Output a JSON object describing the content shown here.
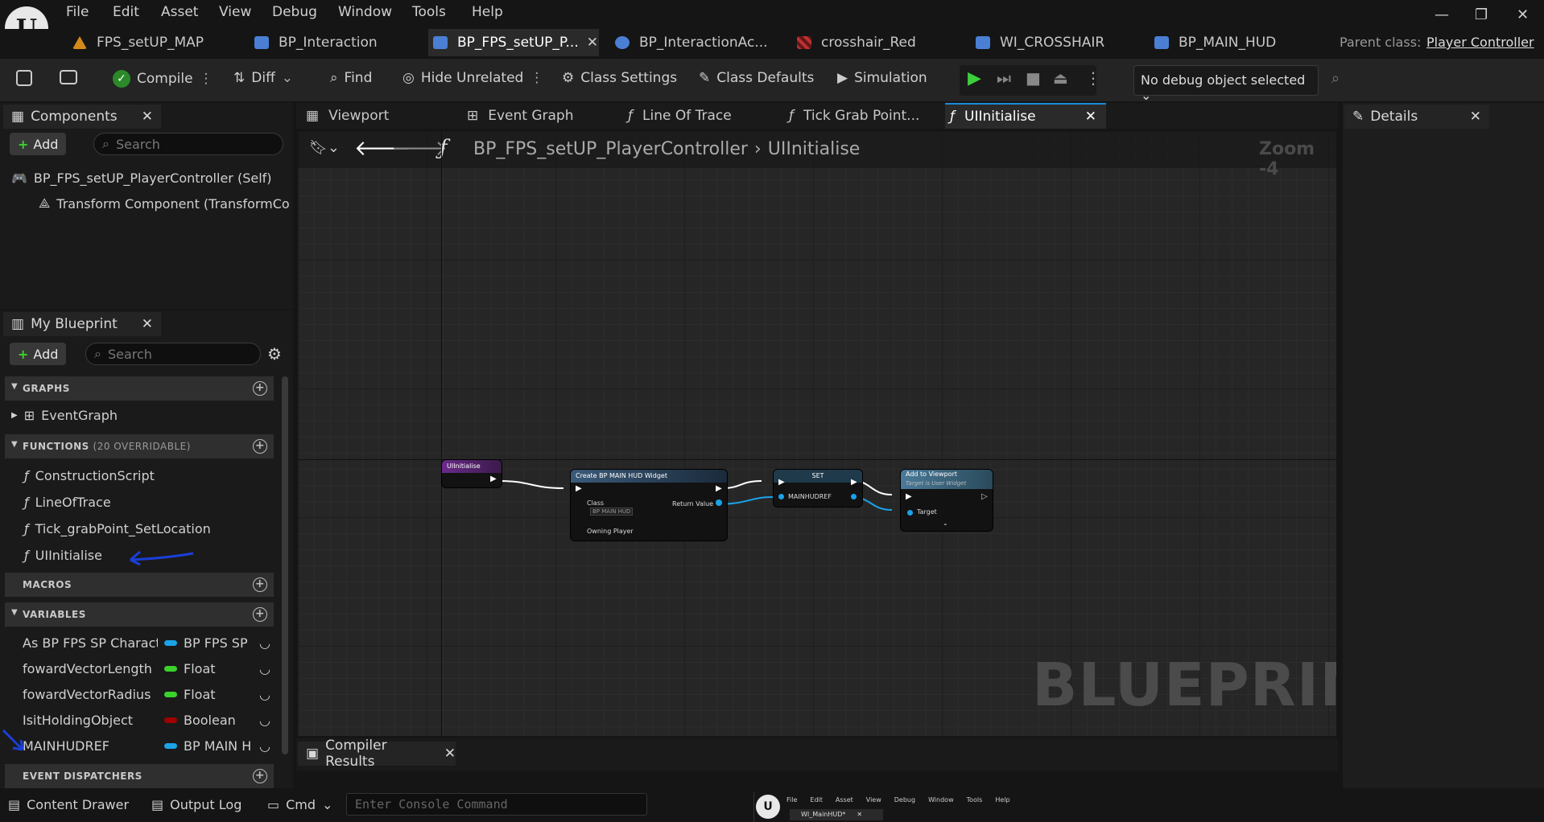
{
  "menu": [
    "File",
    "Edit",
    "Asset",
    "View",
    "Debug",
    "Window",
    "Tools",
    "Help"
  ],
  "doc_tabs": [
    {
      "label": "FPS_setUP_MAP",
      "color": "#d48a1a"
    },
    {
      "label": "BP_Interaction",
      "color": "#4a7fd4"
    },
    {
      "label": "BP_FPS_setUP_P...",
      "color": "#4a7fd4"
    },
    {
      "label": "BP_InteractionAc...",
      "color": "#4a7fd4"
    },
    {
      "label": "crosshair_Red",
      "color": "#c03030"
    },
    {
      "label": "WI_CROSSHAIR",
      "color": "#4a7fd4"
    },
    {
      "label": "BP_MAIN_HUD",
      "color": "#4a7fd4"
    }
  ],
  "parent_class": {
    "label": "Parent class:",
    "value": "Player Controller"
  },
  "toolbar": {
    "compile": "Compile",
    "diff": "Diff",
    "find": "Find",
    "hide_unrelated": "Hide Unrelated",
    "class_settings": "Class Settings",
    "class_defaults": "Class Defaults",
    "simulation": "Simulation",
    "debug_select": "No debug object selected"
  },
  "components": {
    "title": "Components",
    "add": "Add",
    "search_placeholder": "Search",
    "items": [
      "BP_FPS_setUP_PlayerController (Self)",
      "Transform Component (TransformCo"
    ]
  },
  "my_blueprint": {
    "title": "My Blueprint",
    "add": "Add",
    "search_placeholder": "Search",
    "graphs_header": "GRAPHS",
    "graphs": [
      "EventGraph"
    ],
    "functions_header": "FUNCTIONS",
    "functions_suffix": "(20 OVERRIDABLE)",
    "functions": [
      "ConstructionScript",
      "LineOfTrace",
      "Tick_grabPoint_SetLocation",
      "UIInitialise"
    ],
    "macros_header": "MACROS",
    "variables_header": "VARIABLES",
    "variables": [
      {
        "name": "As BP FPS SP Charact",
        "type": "BP FPS SP",
        "color": "#1aa3e8"
      },
      {
        "name": "fowardVectorLength",
        "type": "Float",
        "color": "#3bd22b"
      },
      {
        "name": "fowardVectorRadius",
        "type": "Float",
        "color": "#3bd22b"
      },
      {
        "name": "IsitHoldingObject",
        "type": "Boolean",
        "color": "#a00000"
      },
      {
        "name": "MAINHUDREF",
        "type": "BP MAIN H",
        "color": "#1aa3e8"
      }
    ],
    "dispatchers_header": "EVENT DISPATCHERS"
  },
  "graph_tabs": [
    "Viewport",
    "Event Graph",
    "Line Of Trace",
    "Tick Grab Point...",
    "UIInitialise"
  ],
  "breadcrumb": {
    "root": "BP_FPS_setUP_PlayerController",
    "current": "UIInitialise"
  },
  "zoom": "Zoom -4",
  "watermark": "BLUEPRINT",
  "nodes": {
    "entry": "UIInitialise",
    "create": {
      "title": "Create BP MAIN HUD Widget",
      "class": "Class",
      "class_value": "BP MAIN HUD",
      "return": "Return Value",
      "owner": "Owning Player"
    },
    "set": {
      "title": "SET",
      "var": "MAINHUDREF"
    },
    "add": {
      "title": "Add to Viewport",
      "subtitle": "Target is User Widget",
      "target": "Target"
    }
  },
  "details": {
    "title": "Details"
  },
  "compiler_results": "Compiler Results",
  "bottom": {
    "content_drawer": "Content Drawer",
    "output_log": "Output Log",
    "cmd": "Cmd",
    "console_placeholder": "Enter Console Command"
  },
  "mini_window": {
    "menu": [
      "File",
      "Edit",
      "Asset",
      "View",
      "Debug",
      "Window",
      "Tools",
      "Help"
    ],
    "tab": "WI_MainHUD*"
  }
}
